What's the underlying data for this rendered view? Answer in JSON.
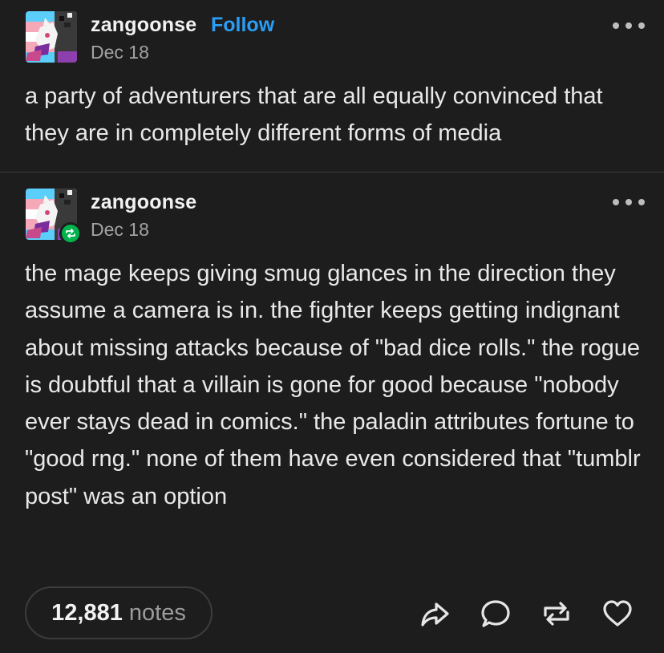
{
  "original_post": {
    "username": "zangoonse",
    "follow_label": "Follow",
    "date": "Dec 18",
    "text": "a party of adventurers that are all equally convinced that they are in completely different forms of media"
  },
  "reblog_post": {
    "username": "zangoonse",
    "date": "Dec 18",
    "paragraphs": [
      "the mage keeps giving smug glances in the direction they assume a camera is in. the fighter keeps getting indignant about missing attacks because of \"bad dice rolls.\" the rogue is doubtful that a villain is gone for good because \"nobody ever stays dead in comics.\" the paladin attributes fortune to \"good rng.\" none of them have even considered that \"tumblr post\" was an option"
    ]
  },
  "footer": {
    "notes_count": "12,881",
    "notes_label": "notes",
    "actions": [
      "share-icon",
      "comment-icon",
      "reblog-icon",
      "like-icon"
    ]
  },
  "colors": {
    "background": "#1d1d1d",
    "follow": "#2a9df4",
    "reblog_badge": "#00b34d",
    "text": "#e9e9e9",
    "muted": "#a3a3a3"
  }
}
